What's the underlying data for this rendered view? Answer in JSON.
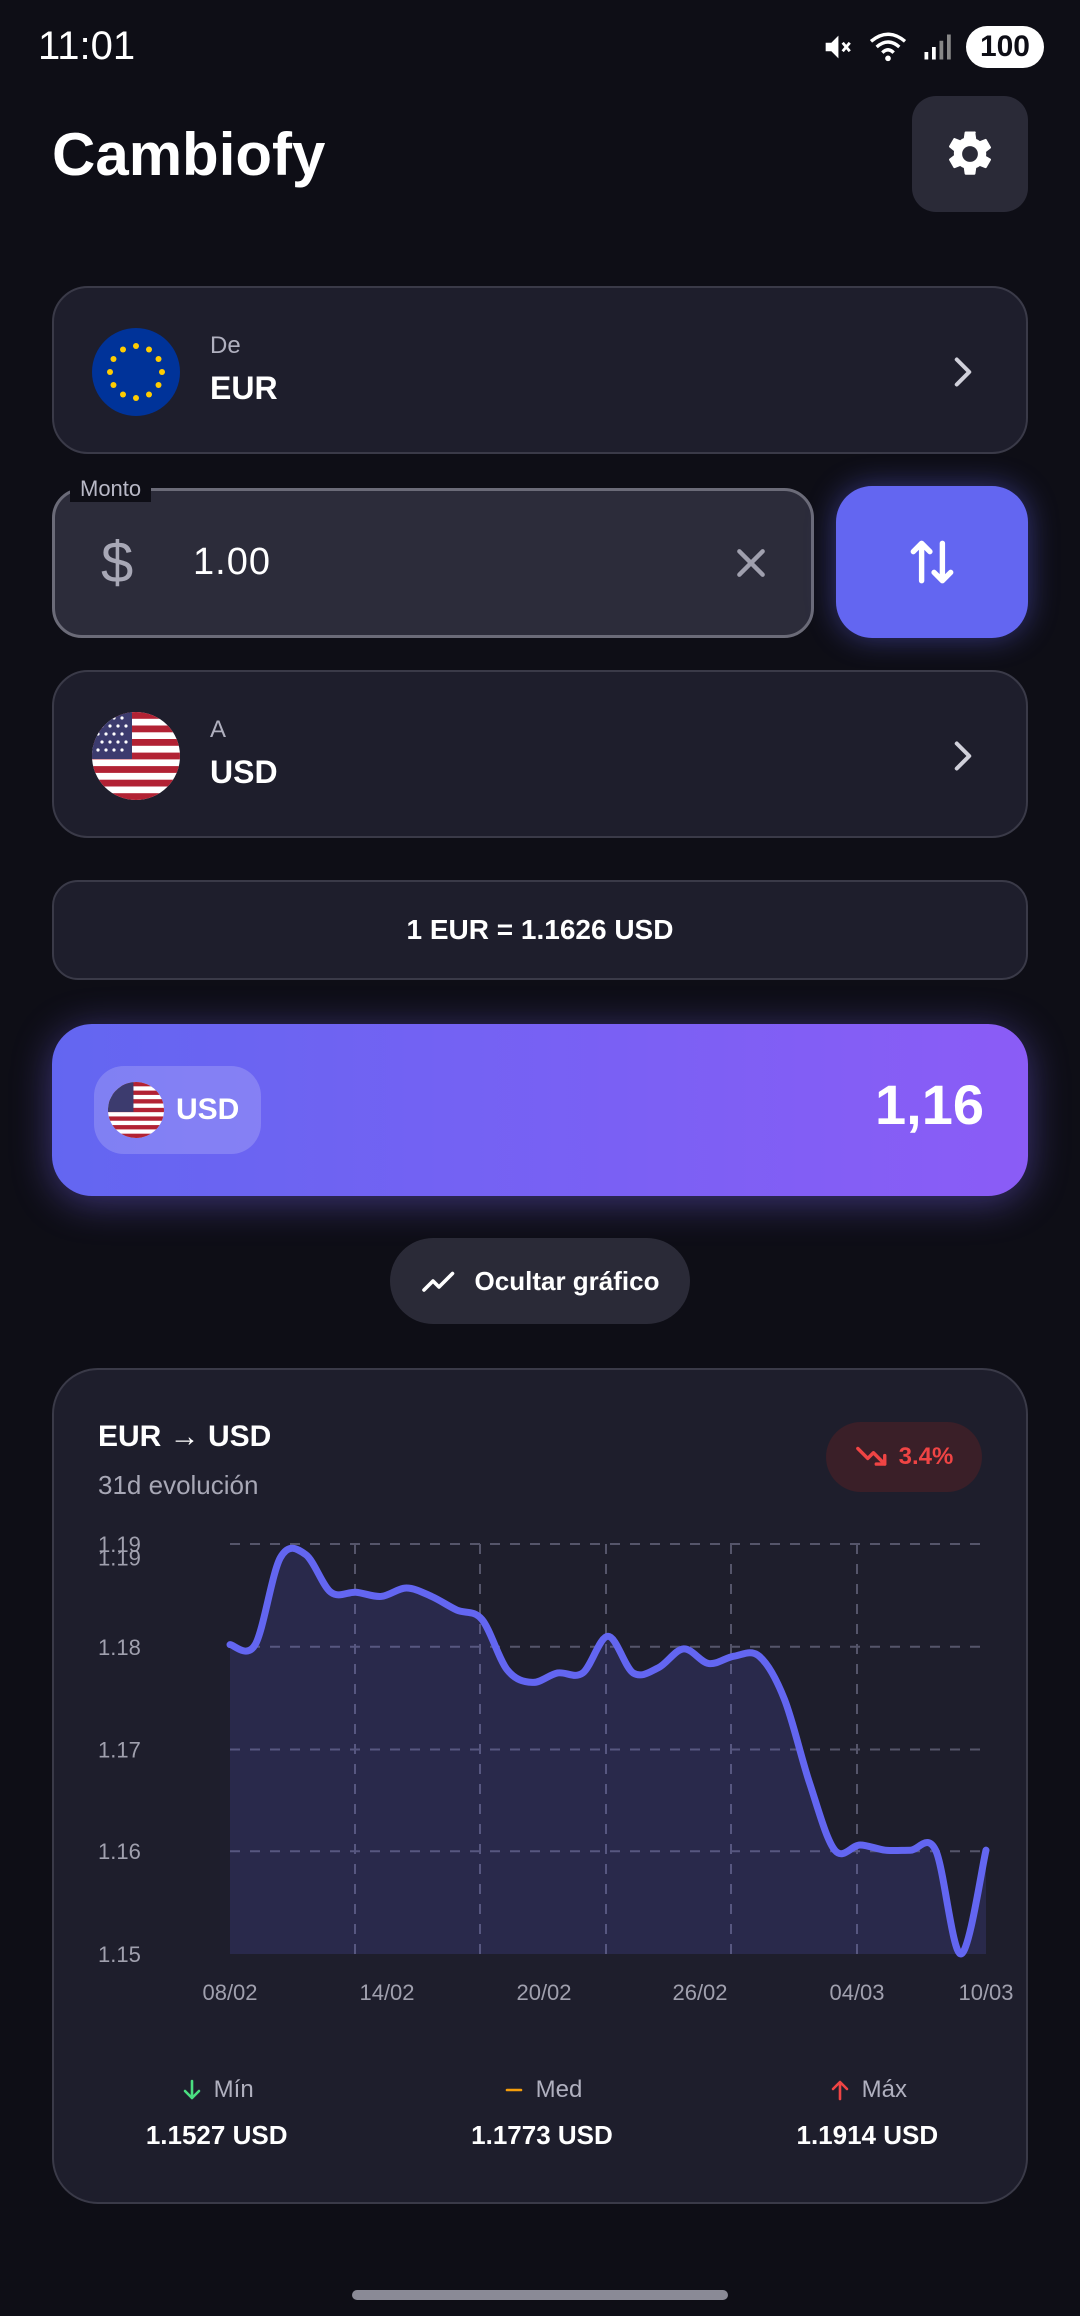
{
  "status": {
    "time": "11:01",
    "battery": "100"
  },
  "app": {
    "title": "Cambiofy"
  },
  "from": {
    "label": "De",
    "code": "EUR"
  },
  "to": {
    "label": "A",
    "code": "USD"
  },
  "amount": {
    "legend": "Monto",
    "symbol": "$",
    "value": "1.00"
  },
  "rate": {
    "text": "1 EUR = 1.1626 USD"
  },
  "result": {
    "code": "USD",
    "value": "1,16"
  },
  "toggle": {
    "label": "Ocultar gráfico"
  },
  "chart": {
    "title": "EUR → USD",
    "subtitle": "31d evolución",
    "change": "3.4%"
  },
  "chart_data": {
    "type": "area",
    "x_tick_labels": [
      "08/02",
      "14/02",
      "20/02",
      "26/02",
      "04/03",
      "10/03"
    ],
    "y_tick_labels": [
      "1.15",
      "1.16",
      "1.17",
      "1.18",
      "1.19",
      "1.19"
    ],
    "y_tick_values": [
      1.1527,
      1.1625,
      1.1722,
      1.182,
      1.1918,
      1.1905
    ],
    "ylim": [
      1.1527,
      1.1918
    ],
    "grid": true,
    "series_color": "#6366f1",
    "values": [
      1.1822,
      1.1822,
      1.1905,
      1.1908,
      1.1872,
      1.1872,
      1.1868,
      1.1876,
      1.1868,
      1.1855,
      1.1846,
      1.1798,
      1.1786,
      1.1795,
      1.1795,
      1.183,
      1.1795,
      1.18,
      1.1818,
      1.1804,
      1.1811,
      1.1811,
      1.177,
      1.169,
      1.1626,
      1.1631,
      1.1626,
      1.1626,
      1.1626,
      1.1527,
      1.1626
    ]
  },
  "stats": [
    {
      "label": "Mín",
      "value": "1.1527 USD",
      "color": "#4ade80"
    },
    {
      "label": "Med",
      "value": "1.1773 USD",
      "color": "#f59e0b"
    },
    {
      "label": "Máx",
      "value": "1.1914 USD",
      "color": "#ef4444"
    }
  ]
}
